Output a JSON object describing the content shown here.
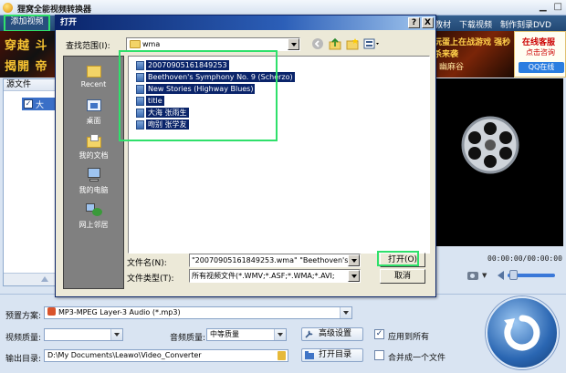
{
  "app": {
    "title": "狸窝全能视频转换器",
    "add_video_label": "添加视频",
    "links": [
      "教材",
      "下载视频",
      "制作刻录DVD"
    ],
    "banner_left_top": "穿越 斗",
    "banner_left_bottom": "揭開 帝",
    "banner_right_top": "玩蛋上在战游戏 强秒杀来袭",
    "banner_right_bottom": "幽麻谷",
    "service_title": "在线客服",
    "service_sub": "点击咨询",
    "service_qq": "QQ在线",
    "source_header": "源文件",
    "source_item_label": "大",
    "time_display": "00:00:00/00:00:00",
    "preset_label": "预置方案:",
    "preset_value": "MP3-MPEG Layer-3 Audio (*.mp3)",
    "video_quality_label": "视频质量:",
    "video_quality_value": "",
    "audio_quality_label": "音频质量:",
    "audio_quality_value": "中等质量",
    "advanced_label": "高级设置",
    "apply_all_label": "应用到所有",
    "apply_all_checked": true,
    "output_label": "输出目录:",
    "output_value": "D:\\My Documents\\Leawo\\Video_Converter",
    "open_dir_label": "打开目录",
    "merge_label": "合并成一个文件",
    "merge_checked": false
  },
  "dialog": {
    "title": "打开",
    "help_btn": "?",
    "close_btn": "X",
    "lookin_label": "查找范围(I):",
    "lookin_value": "wma",
    "places": [
      "Recent",
      "桌面",
      "我的文档",
      "我的电脑",
      "网上邻居"
    ],
    "files": [
      "20070905161849253",
      "Beethoven's Symphony No. 9 (Scherzo)",
      "New Stories (Highway Blues)",
      "title",
      "大海 张雨生",
      "吻别 张学友"
    ],
    "filename_label": "文件名(N):",
    "filename_value": "\"20070905161849253.wma\" \"Beethoven's S",
    "filetype_label": "文件类型(T):",
    "filetype_value": "所有视频文件(*.WMV;*.ASF;*.WMA;*.AVI;",
    "open_btn": "打开(O)",
    "cancel_btn": "取消"
  },
  "colors": {
    "accent_highlight": "#2fe06b",
    "selection": "#0a246a",
    "menubar": "#284f7e"
  }
}
